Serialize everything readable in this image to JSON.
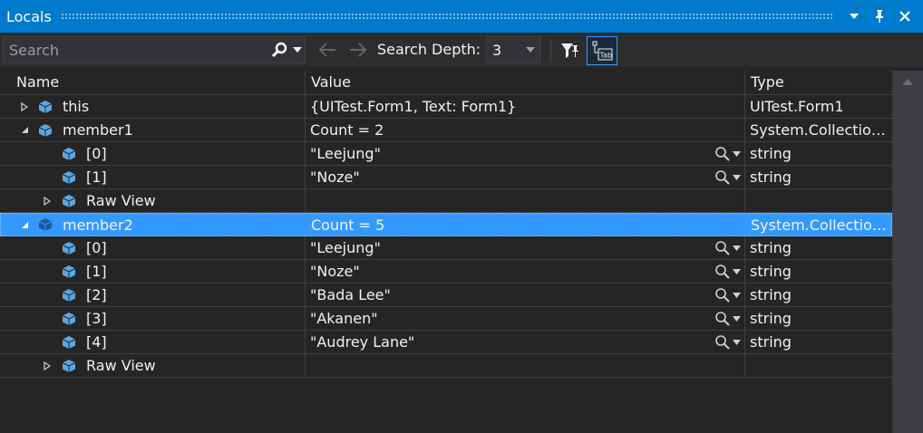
{
  "window": {
    "title": "Locals"
  },
  "toolbar": {
    "search_placeholder": "Search",
    "search_depth_label": "Search Depth:",
    "search_depth_value": "3"
  },
  "columns": {
    "name": "Name",
    "value": "Value",
    "type": "Type"
  },
  "rows": [
    {
      "name": "this",
      "value": "{UITest.Form1, Text: Form1}",
      "type": "UITest.Form1"
    },
    {
      "name": "member1",
      "value": "Count = 2",
      "type": "System.Collection..."
    },
    {
      "name": "[0]",
      "value": "\"Leejung\"",
      "type": "string"
    },
    {
      "name": "[1]",
      "value": "\"Noze\"",
      "type": "string"
    },
    {
      "name": "Raw View",
      "value": "",
      "type": ""
    },
    {
      "name": "member2",
      "value": "Count = 5",
      "type": "System.Collection..."
    },
    {
      "name": "[0]",
      "value": "\"Leejung\"",
      "type": "string"
    },
    {
      "name": "[1]",
      "value": "\"Noze\"",
      "type": "string"
    },
    {
      "name": "[2]",
      "value": "\"Bada Lee\"",
      "type": "string"
    },
    {
      "name": "[3]",
      "value": "\"Akanen\"",
      "type": "string"
    },
    {
      "name": "[4]",
      "value": "\"Audrey Lane\"",
      "type": "string"
    },
    {
      "name": "Raw View",
      "value": "",
      "type": ""
    }
  ],
  "colors": {
    "title_bar": "#007acc",
    "selected_row": "#3399ff",
    "cube_icon": "#5aa7e4",
    "background": "#252526"
  }
}
